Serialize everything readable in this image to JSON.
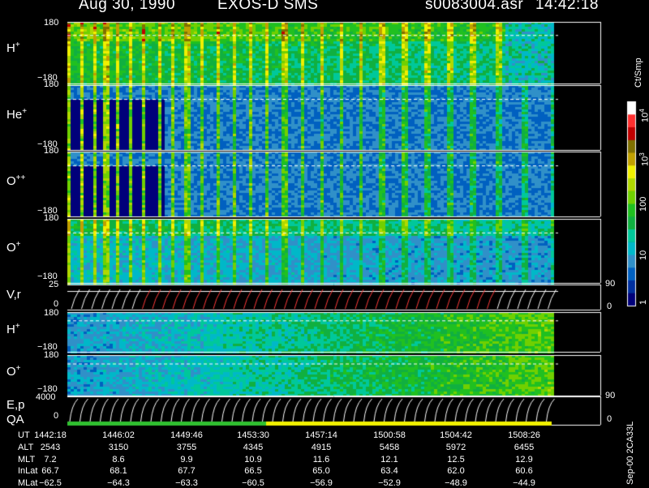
{
  "header": {
    "date": "Aug 30, 1990",
    "instrument": "EXOS-D SMS",
    "file": "s0083004.asr",
    "time": "14:42:18"
  },
  "panels": [
    {
      "species": "H",
      "charge": "+",
      "ymax": "180",
      "ymin": "−180",
      "style": "A"
    },
    {
      "species": "He",
      "charge": "+",
      "ymax": "180",
      "ymin": "−180",
      "style": "B"
    },
    {
      "species": "O",
      "charge": "++",
      "ymax": "180",
      "ymin": "−180",
      "style": "B"
    },
    {
      "species": "O",
      "charge": "+",
      "ymax": "180",
      "ymin": "−180",
      "style": "C"
    }
  ],
  "vr_panel": {
    "label": "V,r",
    "ymax": "25",
    "ymid": "0",
    "right_top": "90",
    "right_bottom": "0"
  },
  "lower_panels": [
    {
      "species": "H",
      "charge": "+",
      "ymax": "180",
      "ymin": "−180"
    },
    {
      "species": "O",
      "charge": "+",
      "ymax": "180",
      "ymin": "−180"
    }
  ],
  "ep_panel": {
    "label": "E,p",
    "label2": "QA",
    "ymax": "4000",
    "ymid": "0",
    "right_top": "90",
    "right_bottom": "0"
  },
  "colorbar": {
    "unit": "Ct/Smp",
    "ticks": [
      "1",
      "10",
      "100",
      "10",
      "10"
    ],
    "tick_exponents": [
      "",
      "",
      "",
      "3",
      "4"
    ],
    "colors": [
      "#00007a",
      "#0030a0",
      "#0060c0",
      "#3090c8",
      "#00b8c8",
      "#00c89a",
      "#10b040",
      "#20c020",
      "#70d000",
      "#b0d800",
      "#f0f000",
      "#c0a000",
      "#807000",
      "#c00000",
      "#ff3030",
      "#ffffff"
    ]
  },
  "footer_note": "Sep-00  2CA33L",
  "table": {
    "row_labels": [
      "UT",
      "ALT",
      "MLT",
      "InLat",
      "MLat"
    ],
    "columns": [
      [
        "1442:18",
        "2543",
        "7.2",
        "66.7",
        "−62.5"
      ],
      [
        "1446:02",
        "3150",
        "8.6",
        "68.1",
        "−64.3"
      ],
      [
        "1449:46",
        "3755",
        "9.9",
        "67.7",
        "−63.3"
      ],
      [
        "1453:30",
        "4345",
        "10.9",
        "66.5",
        "−60.5"
      ],
      [
        "1457:14",
        "4915",
        "11.6",
        "65.0",
        "−56.9"
      ],
      [
        "1500:58",
        "5458",
        "12.1",
        "63.4",
        "−52.9"
      ],
      [
        "1504:42",
        "5972",
        "12.5",
        "62.0",
        "−48.9"
      ],
      [
        "1508:26",
        "6455",
        "12.9",
        "60.6",
        "−44.9"
      ]
    ]
  },
  "qa_bar_colors": [
    "#30c030",
    "#f0f000"
  ]
}
